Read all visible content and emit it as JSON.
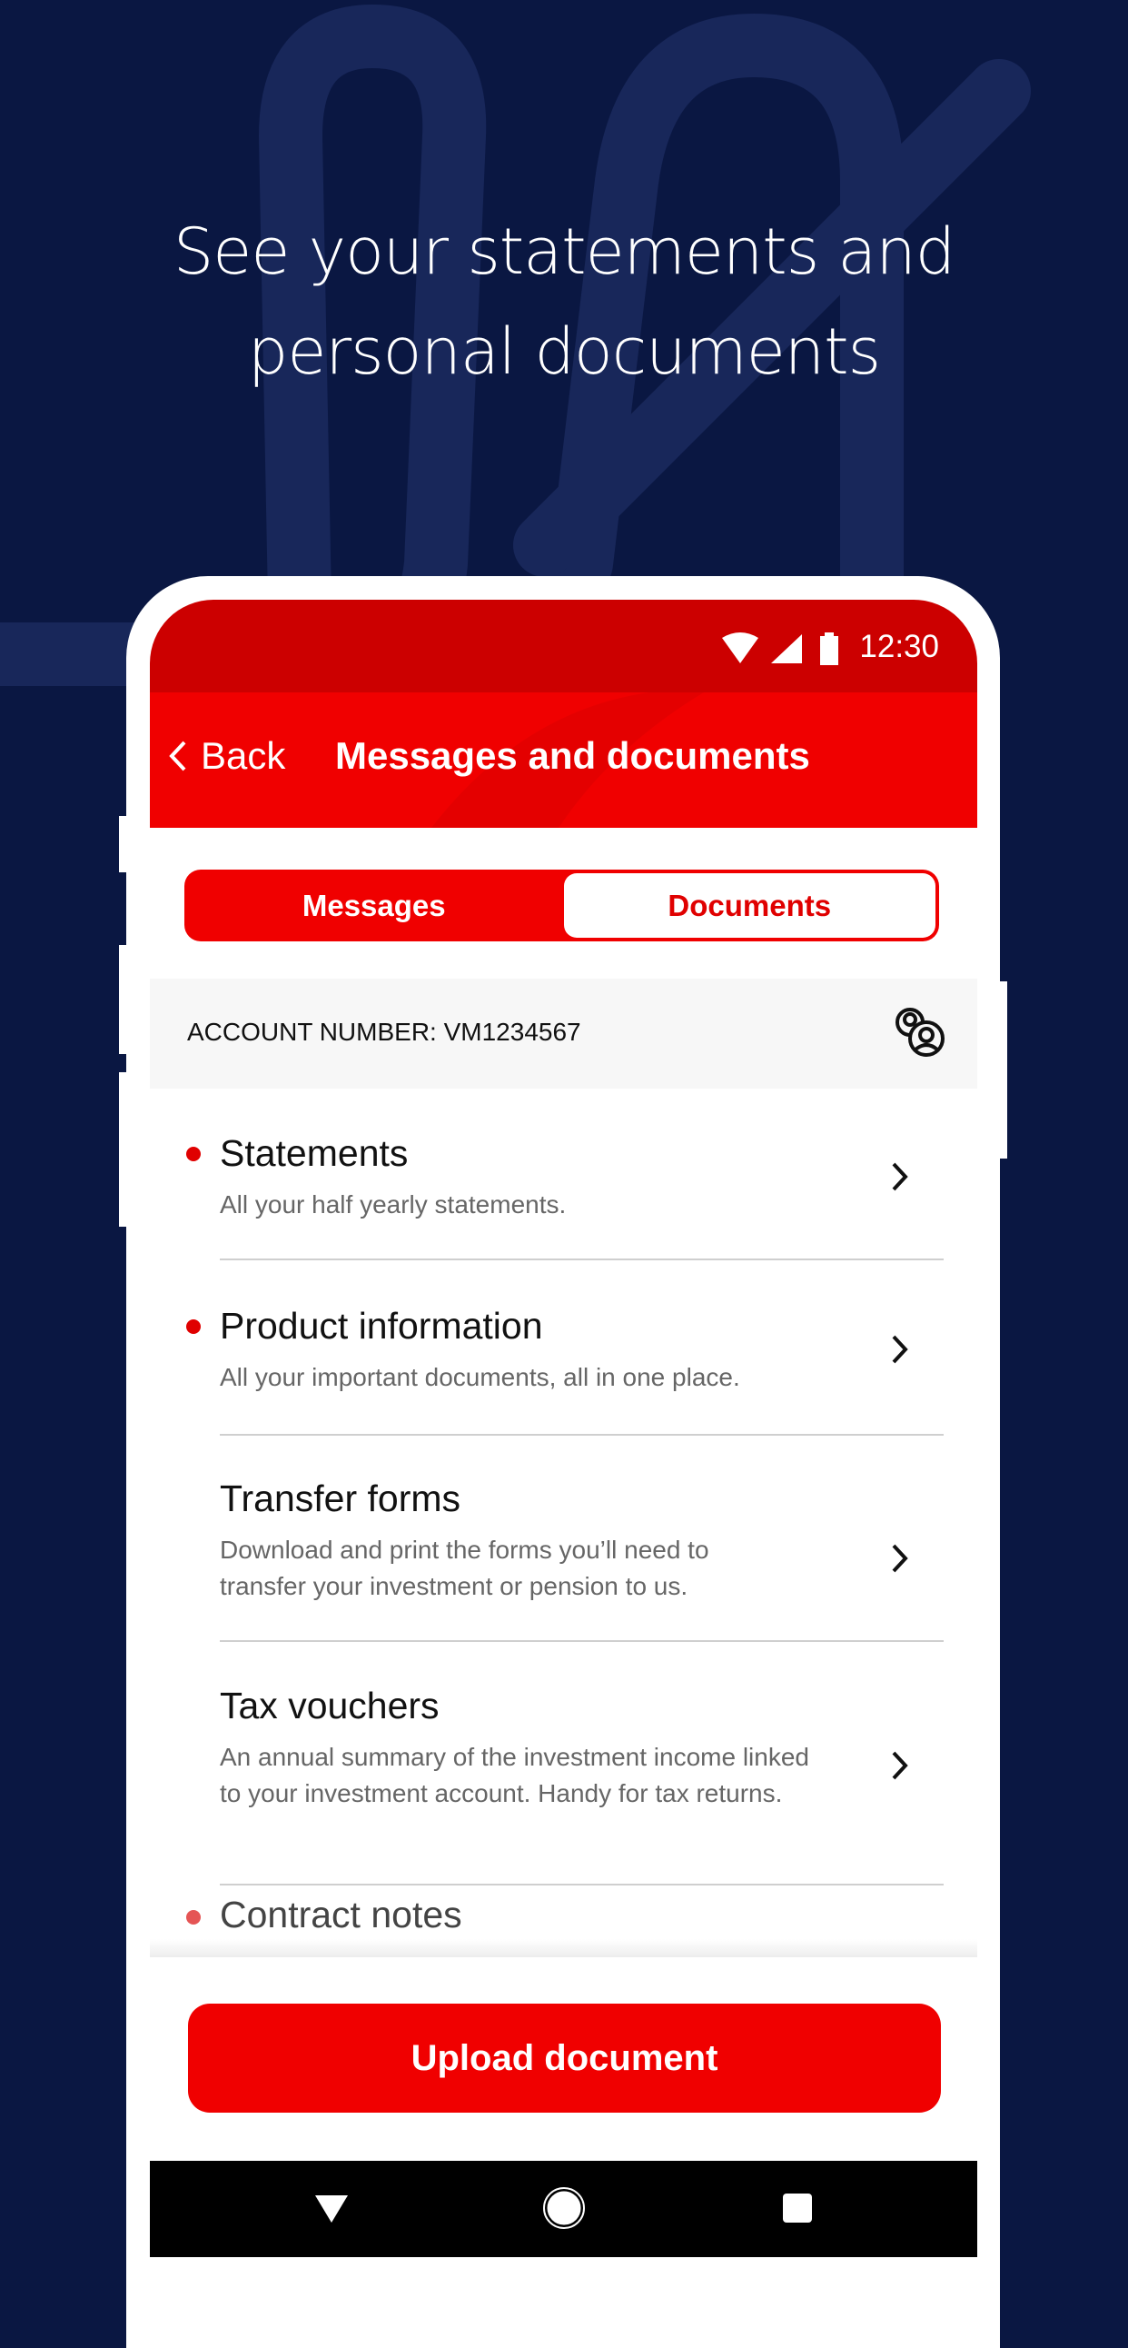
{
  "headline": {
    "line1": "See your statements and",
    "line2": "personal documents"
  },
  "status_bar": {
    "time": "12:30",
    "icons": [
      "wifi-icon",
      "signal-icon",
      "battery-icon"
    ]
  },
  "header": {
    "back_label": "Back",
    "title": "Messages and documents"
  },
  "tabs": [
    {
      "label": "Messages",
      "active": false
    },
    {
      "label": "Documents",
      "active": true
    }
  ],
  "account": {
    "label": "ACCOUNT NUMBER: VM1234567",
    "icon": "switch-account-icon"
  },
  "items": [
    {
      "title": "Statements",
      "subtitle": "All your half yearly statements.",
      "unread": true
    },
    {
      "title": "Product information",
      "subtitle": "All your important documents, all in one place.",
      "unread": true
    },
    {
      "title": "Transfer forms",
      "subtitle": "Download and print the forms you’ll need to transfer your investment or pension to us.",
      "unread": false
    },
    {
      "title": "Tax vouchers",
      "subtitle": "An annual summary of the investment income linked to your investment account. Handy for tax returns.",
      "unread": false
    },
    {
      "title": "Contract notes",
      "subtitle": "",
      "unread": true
    }
  ],
  "upload_button": "Upload document",
  "colors": {
    "background": "#0a1742",
    "brand_red": "#f00000",
    "status_red": "#cc0000"
  },
  "nav": [
    "back-icon",
    "home-icon",
    "recents-icon"
  ]
}
